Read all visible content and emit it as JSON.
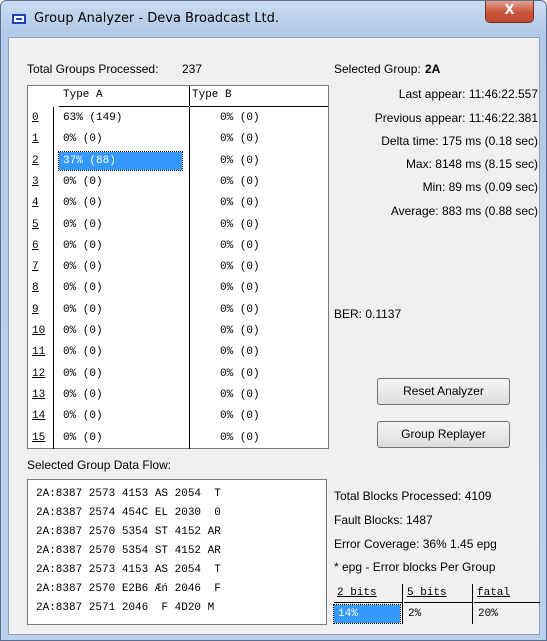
{
  "window": {
    "title": "Group Analyzer - Deva Broadcast Ltd.",
    "close_label": "X"
  },
  "summary": {
    "total_groups_label": "Total Groups Processed:",
    "total_groups_value": "237"
  },
  "groups_table": {
    "col_a": "Type A",
    "col_b": "Type B",
    "rows": [
      {
        "idx": "0",
        "a": "63%  (149)",
        "b": "0%  (0)"
      },
      {
        "idx": "1",
        "a": "0%  (0)",
        "b": "0%  (0)"
      },
      {
        "idx": "2",
        "a": "37%  (88)",
        "b": "0%  (0)",
        "selected": true
      },
      {
        "idx": "3",
        "a": "0%  (0)",
        "b": "0%  (0)"
      },
      {
        "idx": "4",
        "a": "0%  (0)",
        "b": "0%  (0)"
      },
      {
        "idx": "5",
        "a": "0%  (0)",
        "b": "0%  (0)"
      },
      {
        "idx": "6",
        "a": "0%  (0)",
        "b": "0%  (0)"
      },
      {
        "idx": "7",
        "a": "0%  (0)",
        "b": "0%  (0)"
      },
      {
        "idx": "8",
        "a": "0%  (0)",
        "b": "0%  (0)"
      },
      {
        "idx": "9",
        "a": "0%  (0)",
        "b": "0%  (0)"
      },
      {
        "idx": "10",
        "a": "0%  (0)",
        "b": "0%  (0)"
      },
      {
        "idx": "11",
        "a": "0%  (0)",
        "b": "0%  (0)"
      },
      {
        "idx": "12",
        "a": "0%  (0)",
        "b": "0%  (0)"
      },
      {
        "idx": "13",
        "a": "0%  (0)",
        "b": "0%  (0)"
      },
      {
        "idx": "14",
        "a": "0%  (0)",
        "b": "0%  (0)"
      },
      {
        "idx": "15",
        "a": "0%  (0)",
        "b": "0%  (0)"
      }
    ]
  },
  "selected": {
    "group_label": "Selected Group:",
    "group_value": "2A",
    "last_appear": "Last appear:  11:46:22.557",
    "previous_appear": "Previous appear:  11:46:22.381",
    "delta_time": "Delta time:  175 ms (0.18 sec)",
    "max": "Max:  8148 ms (8.15 sec)",
    "min": "Min:  89 ms (0.09 sec)",
    "average": "Average:  883 ms (0.88 sec)",
    "ber": "BER: 0.1137"
  },
  "buttons": {
    "reset": "Reset Analyzer",
    "replayer": "Group Replayer"
  },
  "data_flow": {
    "label": "Selected Group Data Flow:",
    "lines": [
      "2A:8387 2573 4153 AS 2054  T",
      "2A:8387 2574 454C EL 2030  0",
      "2A:8387 2570 5354 ST 4152 AR",
      "2A:8387 2570 5354 ST 4152 AR",
      "2A:8387 2573 4153 AS 2054  T",
      "2A:8387 2570 E2B6 Æń 2046  F",
      "2A:8387 2571 2046  F 4D20 M"
    ]
  },
  "blocks": {
    "total": "Total Blocks Processed:  4109",
    "fault": "Fault Blocks:  1487",
    "coverage": "Error Coverage:  36%  1.45 epg",
    "note": "* epg - Error blocks Per Group"
  },
  "error_table": {
    "headers": [
      "2 bits",
      "5 bits",
      "fatal"
    ],
    "values": [
      "14%",
      "2%",
      "20%"
    ]
  }
}
